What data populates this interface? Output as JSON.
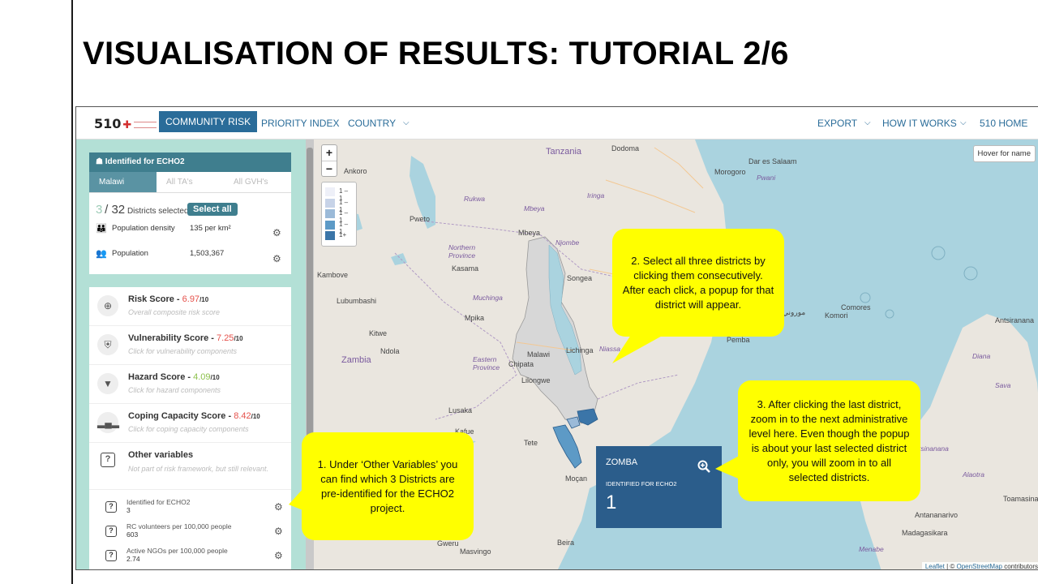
{
  "slide": {
    "title": "VISUALISATION OF RESULTS: TUTORIAL 2/6"
  },
  "nav": {
    "logo": "510",
    "community_risk": "COMMUNITY RISK",
    "priority_index": "PRIORITY INDEX",
    "country": "COUNTRY",
    "export": "EXPORT",
    "how_it_works": "HOW IT WORKS",
    "home": "510 HOME"
  },
  "admin_panel": {
    "title": "Identified for ECHO2",
    "tabs": [
      "Malawi",
      "All TA's",
      "All GVH's"
    ],
    "selected_count": "3",
    "total_count": "32",
    "selected_suffix": "Districts selected",
    "select_all": "Select all",
    "population_density_label": "Population density",
    "population_density_value": "135 per km²",
    "population_label": "Population",
    "population_value": "1,503,367"
  },
  "scores": [
    {
      "title": "Risk Score - ",
      "value": "6.97",
      "denom": "/10",
      "subtitle": "Overall composite risk score",
      "value_color": "#e5514b",
      "icon": "crosshair-icon"
    },
    {
      "title": "Vulnerability Score - ",
      "value": "7.25",
      "denom": "/10",
      "subtitle": "Click for vulnerability components",
      "value_color": "#e5514b",
      "icon": "shield-icon"
    },
    {
      "title": "Hazard Score - ",
      "value": "4.09",
      "denom": "/10",
      "subtitle": "Click for hazard components",
      "value_color": "#8cc04b",
      "icon": "tornado-icon"
    },
    {
      "title": "Coping Capacity Score - ",
      "value": "8.42",
      "denom": "/10",
      "subtitle": "Click for coping capacity components",
      "value_color": "#e5514b",
      "icon": "building-icon"
    },
    {
      "title": "Other variables",
      "value": "",
      "denom": "",
      "subtitle": "Not part of risk framework, but still relevant.",
      "value_color": "#333333",
      "icon": "question-icon"
    }
  ],
  "variables": [
    {
      "label": "Identified for ECHO2",
      "value": "3"
    },
    {
      "label": "RC volunteers per 100,000 people",
      "value": "603"
    },
    {
      "label": "Active NGOs per 100,000 people",
      "value": "2.74"
    }
  ],
  "map": {
    "zoom_in": "+",
    "zoom_out": "−",
    "legend": [
      "1 – 1",
      "1 – 1",
      "1 – 1",
      "1 – 1",
      "1+"
    ],
    "legend_colors": [
      "#eef0f8",
      "#c7d3e8",
      "#9bbad8",
      "#5d9ac6",
      "#3b75a8"
    ],
    "hover_button": "Hover for name",
    "attribution_leaflet": "Leaflet",
    "attribution_sep": " | © ",
    "attribution_osm": "OpenStreetMap",
    "attribution_tail": " contributors",
    "places": {
      "tanzania": "Tanzania",
      "dodoma": "Dodoma",
      "morogoro": "Morogoro",
      "dar": "Dar es Salaam",
      "pwani": "Pwani",
      "ankoro": "Ankoro",
      "rukwa": "Rukwa",
      "iringa": "Iringa",
      "mbeya_r": "Mbeya",
      "pweto": "Pweto",
      "mbeya": "Mbeya",
      "njombe": "Njombe",
      "northern": "Northern",
      "province": "Province",
      "kasama": "Kasama",
      "songea": "Songea",
      "kambove": "Kambove",
      "lubumbashi": "Lubumbashi",
      "muchinga": "Muchinga",
      "mpika": "Mpika",
      "kitwe": "Kitwe",
      "ndola": "Ndola",
      "zambia": "Zambia",
      "lichinga": "Lichinga",
      "niassa": "Niassa",
      "pemba": "Pemba",
      "eastern": "Eastern",
      "chipata": "Chipata",
      "lilongwe": "Lilongwe",
      "malawi": "Malawi",
      "lusaka": "Lusaka",
      "tete": "Tete",
      "mocambique": "Moçan",
      "gweru": "Gweru",
      "masvingo": "Masvingo",
      "beira": "Beira",
      "comores": "Comores",
      "comores_ar": "Komori",
      "moroni": "موروني",
      "antsiranana": "Antsiranana",
      "diana": "Diana",
      "sava": "Sava",
      "mahajanga": "Mahajanga",
      "atsinanana": "tsinanana",
      "toamasina": "Toamasina",
      "antananarivo": "Antananarivo",
      "madagasikara": "Madagasikara",
      "menabe": "Menabe",
      "ilo": "Ilo",
      "alaotra": "Alaotra",
      "kafue": "Kafue"
    }
  },
  "popup": {
    "district": "ZOMBA",
    "label": "IDENTIFIED FOR ECHO2",
    "value": "1"
  },
  "callouts": {
    "c1": "1. Under ‘Other Variables’ you can find which 3 Districts are pre-identified for the ECHO2 project.",
    "c2": "2. Select all three districts by clicking them consecutively. After each click, a popup  for that district will appear.",
    "c3": "3. After clicking the last district, zoom  in to the next administrative level here. Even though the popup is about your last selected district only,  you will zoom  in to all selected districts."
  },
  "colors": {
    "accent": "#2a6c99",
    "sidebar_bg": "#b3e0d6",
    "header_teal": "#3f7e8e",
    "popup_bg": "#2b5d8b",
    "callout": "#ffff00"
  }
}
